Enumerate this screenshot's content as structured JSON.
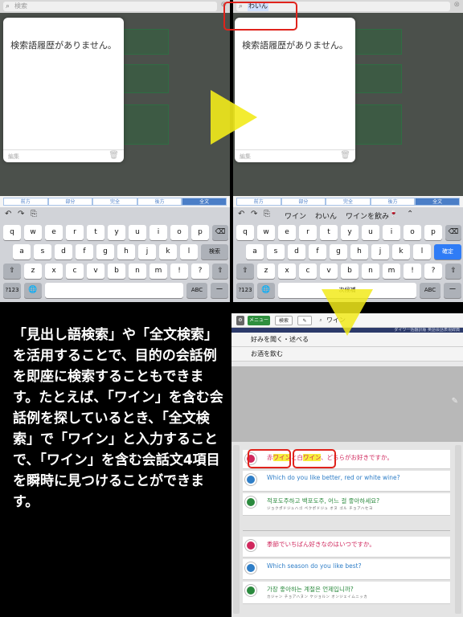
{
  "panel1": {
    "search_placeholder": "検索",
    "history_message": "検索語履歴がありません。",
    "history_edit": "編集",
    "scope_tabs": [
      "前方",
      "部分",
      "完全",
      "後方",
      "全文"
    ],
    "keyboard_row1": [
      "q",
      "w",
      "e",
      "r",
      "t",
      "y",
      "u",
      "i",
      "o",
      "p"
    ],
    "keyboard_row2": [
      "a",
      "s",
      "d",
      "f",
      "g",
      "h",
      "j",
      "k",
      "l"
    ],
    "keyboard_row3": [
      "z",
      "x",
      "c",
      "v",
      "b",
      "n",
      "m",
      "!",
      "?"
    ],
    "return_label": "検索",
    "numbers_label": "?123",
    "abc_label": "ABC",
    "dash_label": "ー"
  },
  "panel2": {
    "typed_text": "わいん",
    "history_message": "検索語履歴がありません。",
    "history_edit": "編集",
    "scope_tabs": [
      "前方",
      "部分",
      "完全",
      "後方",
      "全文"
    ],
    "candidates": [
      "ワイン",
      "わいん",
      "ワインを飲み",
      "🍷"
    ],
    "return_label": "確定",
    "space_label": "次候補",
    "numbers_label": "?123",
    "abc_label": "ABC",
    "dash_label": "ー"
  },
  "panel4": {
    "nav_menu": "メニュー",
    "nav_search": "検索",
    "query": "ワイン",
    "band_text": "ダイワ一括翻訳版 英語会話表現辞典",
    "hits": [
      "好みを聞く・述べる",
      "お酒を飲む"
    ],
    "rows": [
      {
        "parts": [
          "赤",
          "ワイン",
          "と白",
          "ワイン",
          "、どちらがお好きですか。"
        ],
        "color": "#d0285d",
        "sub": ""
      },
      {
        "text": "Which do you like better, red or white wine?",
        "color": "#2f7ec7",
        "sub": ""
      },
      {
        "text": "적포도주하고 백포도주, 어느 걸 좋아하세요?",
        "color": "#2b8a3e",
        "sub": "ジョクポドジュハゴ ペクポドジュ オヌ ゴル チョアハセヨ"
      },
      {
        "text": "季節でいちばん好きなのはいつですか。",
        "color": "#d0285d",
        "sub": ""
      },
      {
        "text": "Which season do you like best?",
        "color": "#2f7ec7",
        "sub": ""
      },
      {
        "text": "가장 좋아하는 계절은 언제입니까?",
        "color": "#2b8a3e",
        "sub": "カジャン チョアハヌン ケジョルン オンジェイムニッカ"
      }
    ]
  },
  "description": "「見出し語検索」や「全文検索」を活用することで、目的の会話例を即座に検索することもできます。たとえば、「ワイン」を含む会話例を探しているとき、「全文検索」で「ワイン」と入力することで、「ワイン」を含む会話文4項目を瞬時に見つけることができます。",
  "colors": {
    "arrow": "#f2ea1b",
    "annotation": "#e0231c",
    "key_blue": "#2f7cf6"
  }
}
